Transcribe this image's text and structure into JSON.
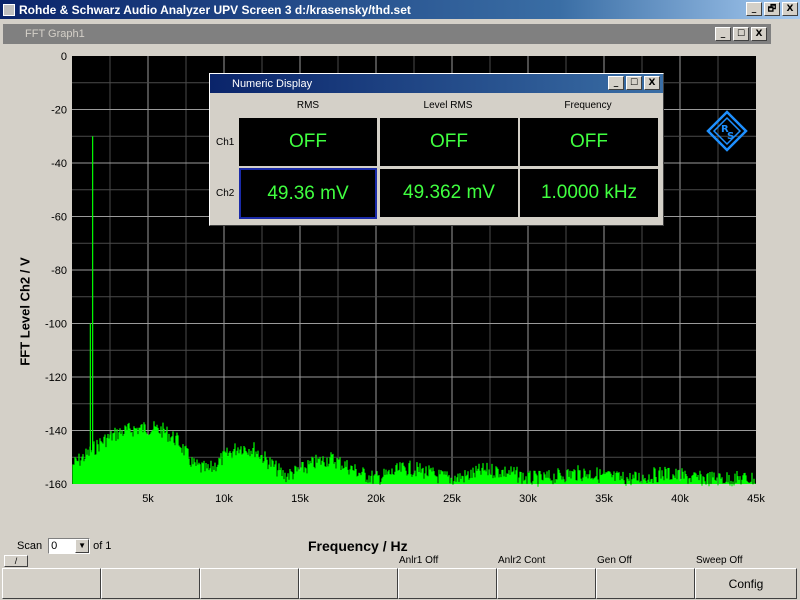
{
  "window": {
    "title": "Rohde & Schwarz Audio Analyzer UPV Screen 3  d:/krasensky/thd.set",
    "controls": [
      "_",
      "🗗",
      "X"
    ]
  },
  "graph": {
    "title": "FFT Graph1",
    "controls": [
      "_",
      "☐",
      "X"
    ],
    "scan_label": "Scan",
    "scan_value": "0",
    "scan_of": "of 1"
  },
  "chart_data": {
    "type": "line",
    "xlabel": "Frequency / Hz",
    "ylabel": "FFT Level Ch2 / V",
    "xlim": [
      0,
      45000
    ],
    "ylim": [
      -160,
      0
    ],
    "grid": true,
    "x_ticks": [
      {
        "value": 5000,
        "label": "5k"
      },
      {
        "value": 10000,
        "label": "10k"
      },
      {
        "value": 15000,
        "label": "15k"
      },
      {
        "value": 20000,
        "label": "20k"
      },
      {
        "value": 25000,
        "label": "25k"
      },
      {
        "value": 30000,
        "label": "30k"
      },
      {
        "value": 35000,
        "label": "35k"
      },
      {
        "value": 40000,
        "label": "40k"
      },
      {
        "value": 45000,
        "label": "45k"
      }
    ],
    "y_ticks": [
      0,
      -20,
      -40,
      -60,
      -80,
      -100,
      -120,
      -140,
      -160
    ],
    "series": [
      {
        "color": "#00ff00",
        "peaks": [
          {
            "x": 700,
            "y": -30
          },
          {
            "x": 550,
            "y": -100
          }
        ],
        "envelope": [
          {
            "x": 0,
            "y": -150
          },
          {
            "x": 1000,
            "y": -146
          },
          {
            "x": 2000,
            "y": -141
          },
          {
            "x": 3000,
            "y": -138
          },
          {
            "x": 4000,
            "y": -136.5
          },
          {
            "x": 5000,
            "y": -136
          },
          {
            "x": 6000,
            "y": -137
          },
          {
            "x": 7000,
            "y": -141
          },
          {
            "x": 8000,
            "y": -150
          },
          {
            "x": 9000,
            "y": -152
          },
          {
            "x": 10000,
            "y": -147
          },
          {
            "x": 11000,
            "y": -143
          },
          {
            "x": 12000,
            "y": -144
          },
          {
            "x": 13000,
            "y": -149
          },
          {
            "x": 14000,
            "y": -154
          },
          {
            "x": 15000,
            "y": -152
          },
          {
            "x": 16000,
            "y": -149
          },
          {
            "x": 17000,
            "y": -147.5
          },
          {
            "x": 18000,
            "y": -150
          },
          {
            "x": 19000,
            "y": -153
          },
          {
            "x": 20000,
            "y": -155
          },
          {
            "x": 21000,
            "y": -153
          },
          {
            "x": 22000,
            "y": -151
          },
          {
            "x": 23000,
            "y": -152
          },
          {
            "x": 24000,
            "y": -154
          },
          {
            "x": 25000,
            "y": -155
          },
          {
            "x": 26000,
            "y": -154
          },
          {
            "x": 27000,
            "y": -152
          },
          {
            "x": 28000,
            "y": -152
          },
          {
            "x": 29000,
            "y": -153
          },
          {
            "x": 30000,
            "y": -155
          },
          {
            "x": 31000,
            "y": -155
          },
          {
            "x": 32000,
            "y": -154
          },
          {
            "x": 33000,
            "y": -153
          },
          {
            "x": 34000,
            "y": -153
          },
          {
            "x": 35000,
            "y": -154
          },
          {
            "x": 36000,
            "y": -155
          },
          {
            "x": 37000,
            "y": -155
          },
          {
            "x": 38000,
            "y": -154
          },
          {
            "x": 39000,
            "y": -153
          },
          {
            "x": 40000,
            "y": -154
          },
          {
            "x": 41000,
            "y": -155
          },
          {
            "x": 42000,
            "y": -155
          },
          {
            "x": 43000,
            "y": -155
          },
          {
            "x": 44000,
            "y": -155
          },
          {
            "x": 45000,
            "y": -155
          }
        ]
      }
    ]
  },
  "numeric_display": {
    "title": "Numeric Display",
    "controls": [
      "_",
      "☐",
      "X"
    ],
    "columns": [
      "RMS",
      "Level RMS",
      "Frequency"
    ],
    "rows": [
      {
        "label": "Ch1",
        "values": [
          "OFF",
          "OFF",
          "OFF"
        ]
      },
      {
        "label": "Ch2",
        "values": [
          "49.36 mV",
          "49.362 mV",
          "1.0000 kHz"
        ]
      }
    ]
  },
  "softkeys": {
    "corner": "/",
    "labels": [
      "Anlr1 Off",
      "Anlr2 Cont",
      "Gen Off",
      "Sweep Off"
    ],
    "buttons": [
      "",
      "",
      "",
      "",
      "",
      "",
      "",
      "Config"
    ]
  },
  "colors": {
    "plot_bg": "#000000",
    "trace": "#00ff00",
    "grid": "#808080",
    "readout": "#40ff40",
    "selection": "#1a2aa8"
  }
}
